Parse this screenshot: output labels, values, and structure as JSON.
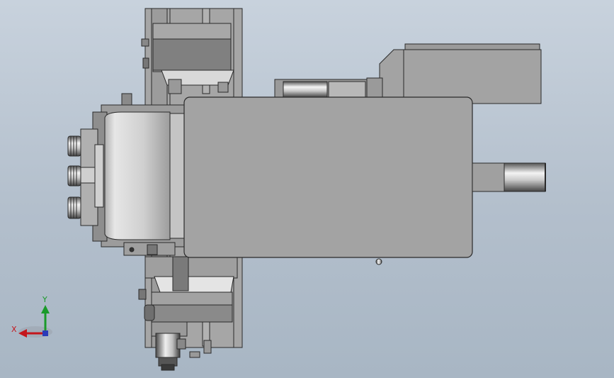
{
  "viewport": {
    "background_top": "#c8d2dd",
    "background_bottom": "#a8b6c4"
  },
  "triad": {
    "x_label": "X",
    "y_label": "Y",
    "x_color": "#c4161c",
    "y_color": "#1a9a2a",
    "z_color": "#2b3bb8"
  },
  "model": {
    "body_color": "#a3a3a3",
    "edge_color": "#2a2a2a",
    "shade_color": "#7e7e7e",
    "light_color": "#d8d8d8"
  }
}
